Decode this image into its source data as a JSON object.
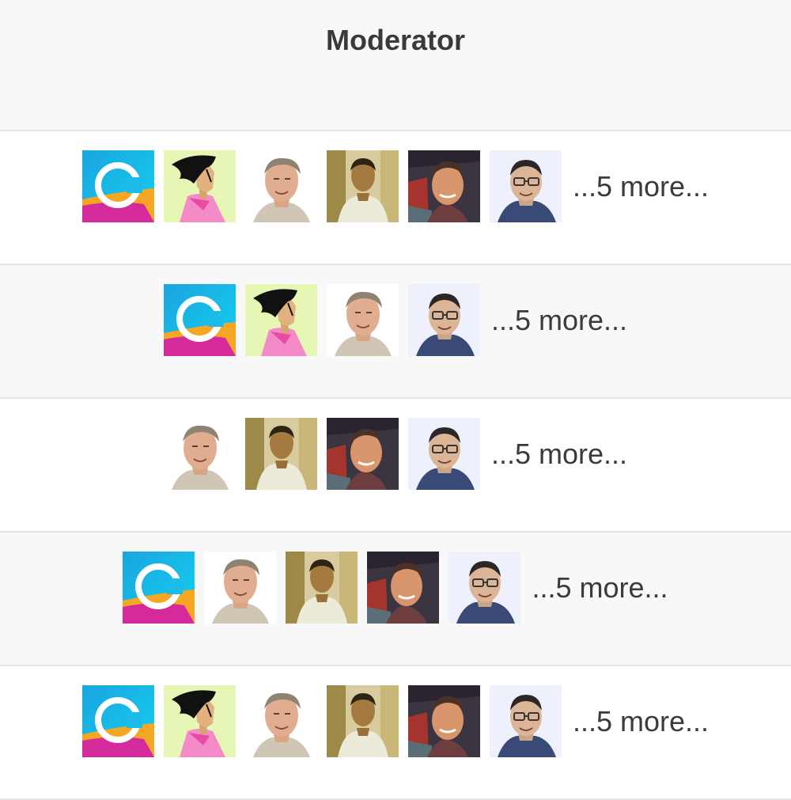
{
  "header": {
    "title": "Moderator"
  },
  "rows": [
    {
      "avatars": [
        "app-logo",
        "woman-illustration",
        "man-grey-hair",
        "man-sepia",
        "man-car",
        "man-glasses"
      ],
      "more": "...5 more..."
    },
    {
      "avatars": [
        "app-logo",
        "woman-illustration",
        "man-grey-hair",
        "man-glasses"
      ],
      "more": "...5 more..."
    },
    {
      "avatars": [
        "man-grey-hair",
        "man-sepia",
        "man-car",
        "man-glasses"
      ],
      "more": "...5 more..."
    },
    {
      "avatars": [
        "app-logo",
        "man-grey-hair",
        "man-sepia",
        "man-car",
        "man-glasses"
      ],
      "more": "...5 more..."
    },
    {
      "avatars": [
        "app-logo",
        "woman-illustration",
        "man-grey-hair",
        "man-sepia",
        "man-car",
        "man-glasses"
      ],
      "more": "...5 more..."
    }
  ]
}
